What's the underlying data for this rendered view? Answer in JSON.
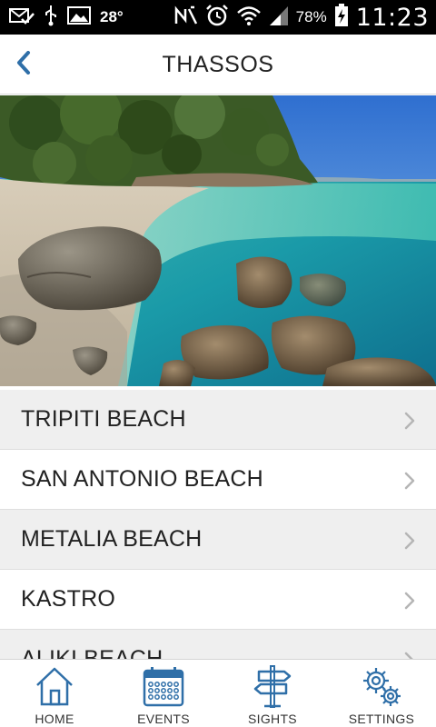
{
  "status_bar": {
    "temperature": "28°",
    "battery": "78%",
    "time": "11:23"
  },
  "header": {
    "title": "THASSOS",
    "back_icon": "chevron-left-icon",
    "accent_color": "#2f6fa8"
  },
  "hero": {
    "image": "beach-photo"
  },
  "list": {
    "items": [
      {
        "label": "TRIPITI BEACH"
      },
      {
        "label": "SAN ANTONIO BEACH"
      },
      {
        "label": "METALIA BEACH"
      },
      {
        "label": "KASTRO"
      },
      {
        "label": "ALIKI BEACH"
      }
    ]
  },
  "bottom_nav": {
    "items": [
      {
        "label": "HOME",
        "icon": "home-icon"
      },
      {
        "label": "EVENTS",
        "icon": "calendar-icon"
      },
      {
        "label": "SIGHTS",
        "icon": "signpost-icon"
      },
      {
        "label": "SETTINGS",
        "icon": "gears-icon"
      }
    ],
    "icon_color": "#2f6fa8"
  }
}
